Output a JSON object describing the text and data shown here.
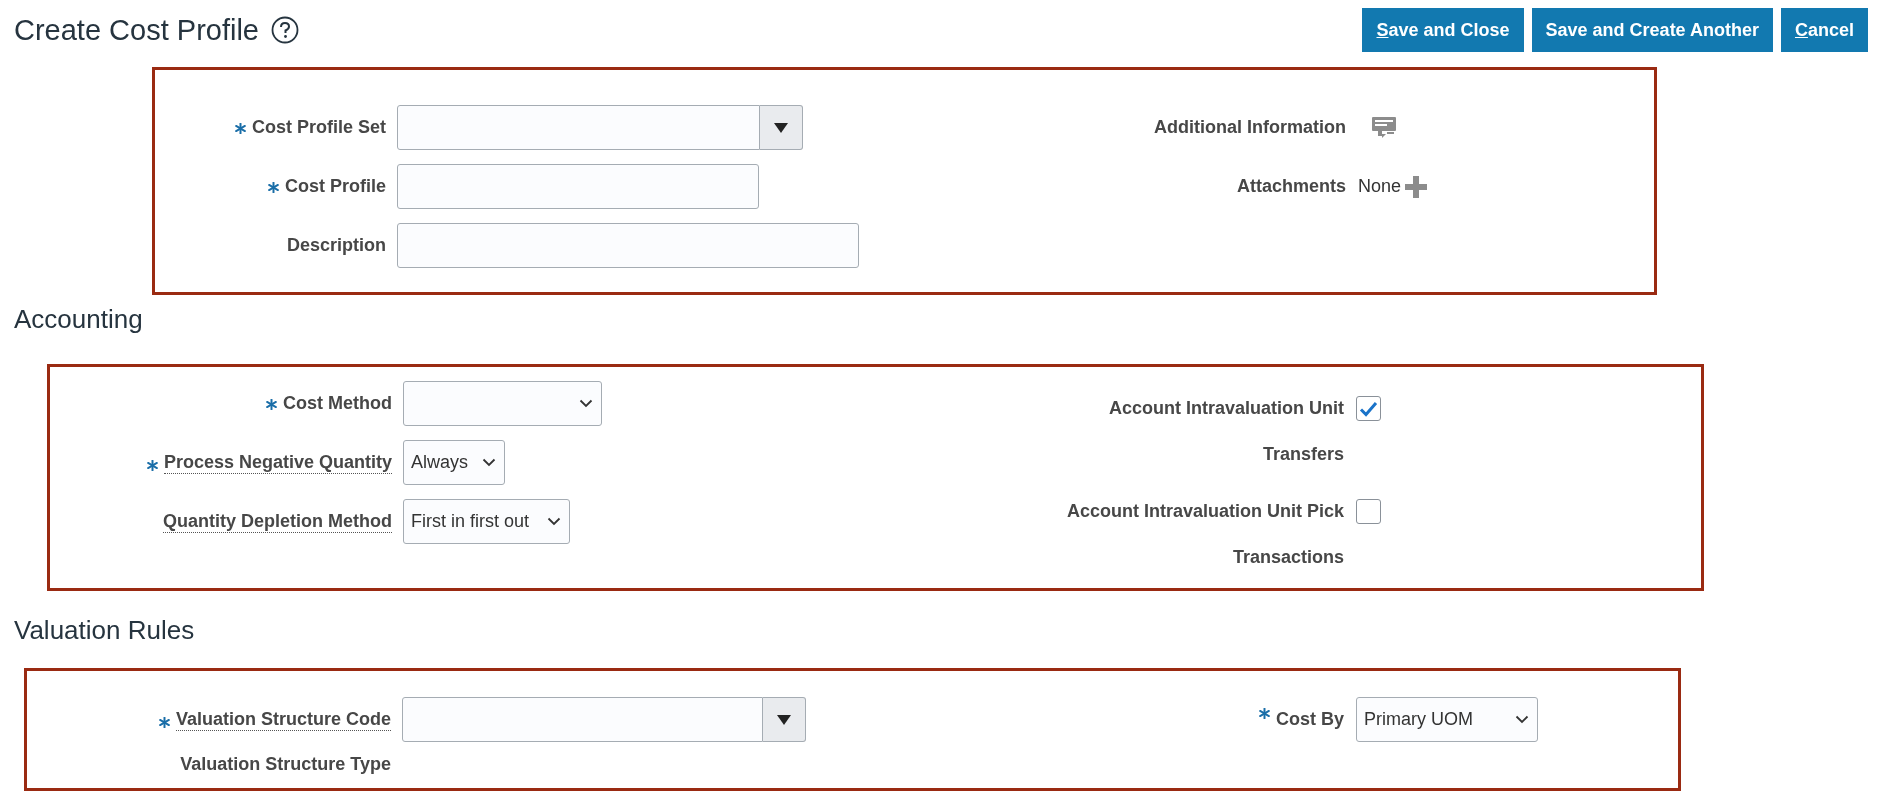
{
  "page": {
    "title": "Create Cost Profile"
  },
  "buttons": [
    {
      "label": "Save and Close",
      "mnemonic": true
    },
    {
      "label": "Save and Create Another",
      "mnemonic": false
    },
    {
      "label": "Cancel",
      "mnemonic": true
    }
  ],
  "header_form": {
    "left_fields": [
      {
        "kind": "lov",
        "label": "Cost Profile Set",
        "required": true,
        "help": false
      },
      {
        "kind": "text",
        "label": "Cost Profile",
        "required": true,
        "help": false
      },
      {
        "kind": "text",
        "label": "Description",
        "required": false,
        "help": false
      }
    ],
    "right_fields": [
      {
        "kind": "info_icon",
        "label": "Additional Information"
      },
      {
        "kind": "attachments",
        "label": "Attachments",
        "value": "None"
      }
    ]
  },
  "sections": [
    {
      "heading": "Accounting",
      "left_fields": [
        {
          "kind": "select",
          "label": "Cost Method",
          "required": true,
          "help": false
        },
        {
          "kind": "select",
          "label": "Process Negative Quantity",
          "required": true,
          "help": true,
          "value": "Always"
        },
        {
          "kind": "select",
          "label": "Quantity Depletion Method",
          "required": false,
          "help": true,
          "value": "First in first out"
        }
      ],
      "right_fields": [
        {
          "kind": "checkbox",
          "label": "Account Intravaluation Unit Transfers",
          "checked": true
        },
        {
          "kind": "checkbox",
          "label": "Account Intravaluation Unit Pick Transactions",
          "checked": false
        }
      ]
    },
    {
      "heading": "Valuation Rules",
      "left_fields": [
        {
          "kind": "lov",
          "label": "Valuation Structure Code",
          "required": true,
          "help": true
        },
        {
          "kind": "label_only",
          "label": "Valuation Structure Type",
          "required": false,
          "help": false
        }
      ],
      "right_fields": [
        {
          "kind": "select",
          "label": "Cost By",
          "required": true,
          "value": "Primary UOM"
        }
      ]
    }
  ]
}
